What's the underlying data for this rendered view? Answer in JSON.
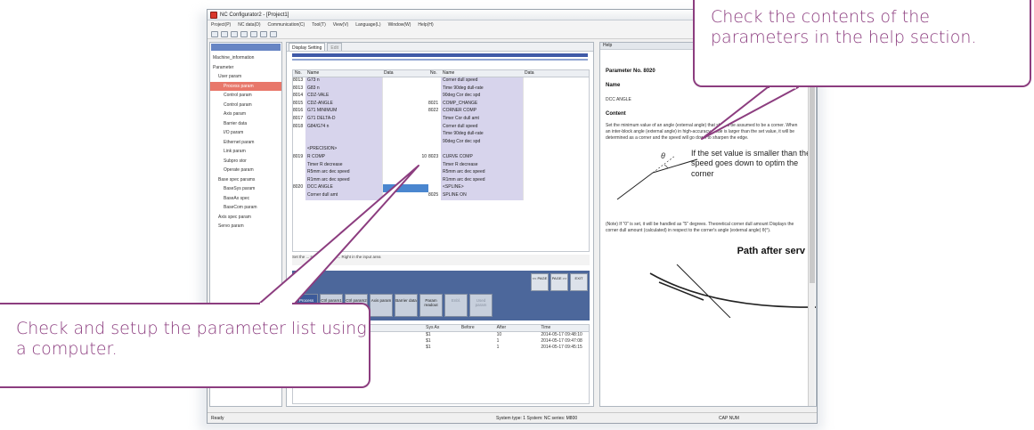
{
  "window": {
    "title": "NC Configurator2 - [Project1]",
    "menus": [
      "Project(P)",
      "NC data(D)",
      "Communication(C)",
      "Tool(T)",
      "View(V)",
      "Language(L)",
      "Window(W)",
      "Help(H)"
    ],
    "status_left": "Ready",
    "status_mid": "System type: 1  System: NC series: M800",
    "status_right": "CAP  NUM"
  },
  "sidebar": {
    "items": [
      {
        "label": "Machine_information",
        "indent": 0,
        "selected": false
      },
      {
        "label": "Parameter",
        "indent": 0,
        "selected": false
      },
      {
        "label": "User param",
        "indent": 1,
        "selected": false
      },
      {
        "label": "Process param",
        "indent": 2,
        "selected": true
      },
      {
        "label": "Control param",
        "indent": 2,
        "selected": false
      },
      {
        "label": "Control param",
        "indent": 2,
        "selected": false
      },
      {
        "label": "Axis param",
        "indent": 2,
        "selected": false
      },
      {
        "label": "Barrier data",
        "indent": 2,
        "selected": false
      },
      {
        "label": "I/O param",
        "indent": 2,
        "selected": false
      },
      {
        "label": "Ethernet param",
        "indent": 2,
        "selected": false
      },
      {
        "label": "Link param",
        "indent": 2,
        "selected": false
      },
      {
        "label": "Subpro stor",
        "indent": 2,
        "selected": false
      },
      {
        "label": "Operate param",
        "indent": 2,
        "selected": false
      },
      {
        "label": "Base spec params",
        "indent": 1,
        "selected": false
      },
      {
        "label": "BaseSys param",
        "indent": 2,
        "selected": false
      },
      {
        "label": "BaseAx spec",
        "indent": 2,
        "selected": false
      },
      {
        "label": "BaseCom param",
        "indent": 2,
        "selected": false
      },
      {
        "label": "Axis spec param",
        "indent": 1,
        "selected": false
      },
      {
        "label": "Servo param",
        "indent": 1,
        "selected": false
      }
    ]
  },
  "main": {
    "tabs": [
      "Display Setting",
      "Edit"
    ],
    "table_headers": [
      "No.",
      "Name",
      "Data",
      "No.",
      "Name",
      "Data"
    ],
    "rows": [
      {
        "no": "8013",
        "name": "G73 n",
        "no2": "",
        "name2": "Corner dull speed"
      },
      {
        "no": "8013",
        "name": "G83 n",
        "no2": "",
        "name2": "Time 90deg dull-rate"
      },
      {
        "no": "8014",
        "name": "CDZ-VALE",
        "no2": "",
        "name2": "90deg Cor dec spd"
      },
      {
        "no": "8015",
        "name": "CDZ-ANGLE",
        "no2": "8021",
        "name2": "COMP_CHANGE"
      },
      {
        "no": "8016",
        "name": "G71 MINIMUM",
        "no2": "8022",
        "name2": "CORNER COMP"
      },
      {
        "no": "8017",
        "name": "G71 DELTA-D",
        "no2": "",
        "name2": "Timer Cor dull amt"
      },
      {
        "no": "8018",
        "name": "G84/G74 n",
        "no2": "",
        "name2": "Corner dull speed"
      },
      {
        "no": "",
        "name": "",
        "no2": "",
        "name2": "Time 90deg dull-rate"
      },
      {
        "no": "",
        "name": "",
        "no2": "",
        "name2": "90deg Cor dec spd"
      },
      {
        "no": "",
        "name": "<PRECISION>",
        "no2": "",
        "name2": ""
      },
      {
        "no": "8019",
        "name": "R COMP",
        "no2": "8023",
        "name2": "CURVE COMP"
      },
      {
        "no": "",
        "name": "Timer R decrease",
        "no2": "",
        "name2": "Timer R decrease"
      },
      {
        "no": "",
        "name": "R5mm arc dec speed",
        "no2": "",
        "name2": "R5mm arc dec speed"
      },
      {
        "no": "",
        "name": "R1mm arc dec speed",
        "no2": "",
        "name2": "R1mm arc dec speed"
      },
      {
        "no": "8020",
        "name": "DCC ANGLE",
        "no2": "",
        "name2": "<SPLINE>"
      },
      {
        "no": "",
        "name": "Corner dull amt",
        "no2": "8025",
        "name2": "SPLINE ON"
      }
    ],
    "highlight_row": 14,
    "val_10": "10",
    "note": "Set the ... surrounded by ... Right in the input area",
    "nav_buttons": [
      "<< PAGE",
      "PAGE >>",
      "EXIT"
    ],
    "fkeys": [
      {
        "label": "Process param",
        "active": true,
        "dim": false
      },
      {
        "label": "Ctrl param1",
        "active": false,
        "dim": false
      },
      {
        "label": "Ctrl param2",
        "active": false,
        "dim": false
      },
      {
        "label": "Axis param",
        "active": false,
        "dim": false
      },
      {
        "label": "Barrier data",
        "active": false,
        "dim": false
      },
      {
        "label": "Param readout",
        "active": false,
        "dim": false
      },
      {
        "label": "Enbl.",
        "active": false,
        "dim": true
      },
      {
        "label": "Used param",
        "active": false,
        "dim": true
      }
    ],
    "history_headers": [
      "Sys Ax",
      "Before",
      "After",
      "Time"
    ],
    "history": [
      {
        "sys": "$1",
        "before": "",
        "after": "10",
        "time": "2014-05-17 09:48:10"
      },
      {
        "sys": "$1",
        "before": "",
        "after": "1",
        "time": "2014-05-17 09:47:08"
      },
      {
        "sys": "$1",
        "before": "",
        "after": "1",
        "time": "2014-05-17 09:45:15"
      }
    ]
  },
  "help": {
    "pane_title": "Help",
    "param_no": "Parameter No. 8020",
    "name_heading": "Name",
    "name_value": "DCC ANGLE",
    "content_heading": "Content",
    "content_text": "Set the minimum value of an angle (external angle) that should be assumed to be a corner. When an inter-block angle (external angle) in high-accuracy mode is larger than the set value, it will be determined as a corner and the speed will go down to sharpen the edge.",
    "figure_text": "If the set value is smaller than the speed goes down to optim the corner",
    "theta": "θ",
    "note_text": "(Note) If \"0\" is set, it will be handled as \"5\" degrees. Theoretical corner dull amount Displays the corner dull amount (calculated) in respect to the corner's angle (external angle) θ(°).",
    "path_title": "Path after serv"
  },
  "callouts": {
    "help": "Check the contents of the parameters in the help section.",
    "list": "Check and setup the parameter list using a computer."
  },
  "colors": {
    "callout": "#8c3d7f",
    "selection": "#e8776a",
    "nav": "#4c679b",
    "header": "#6785c4"
  }
}
